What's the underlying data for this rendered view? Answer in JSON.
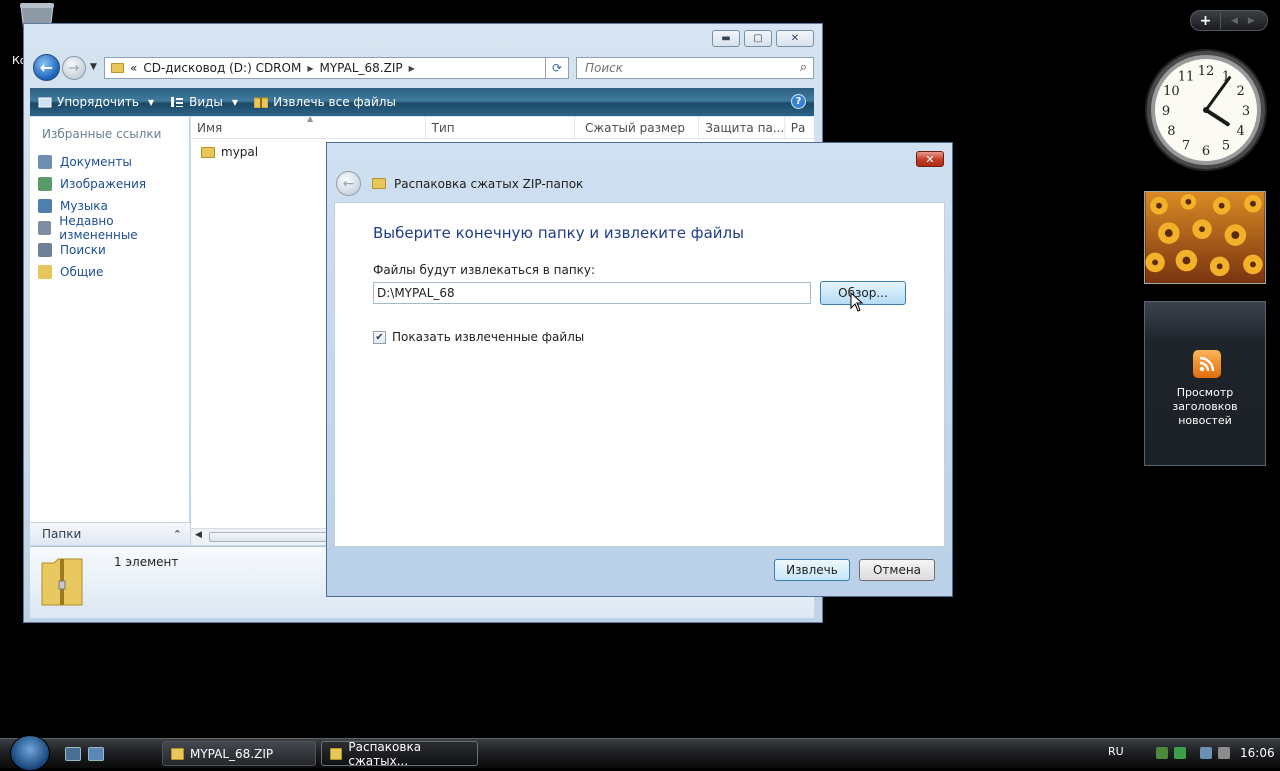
{
  "desktop": {
    "fragment_text": "Ко"
  },
  "explorer": {
    "address": {
      "prefix": "«",
      "part1": "CD-дисковод (D:) CDROM",
      "part2": "MYPAL_68.ZIP"
    },
    "search_placeholder": "Поиск",
    "toolbar": {
      "organize": "Упорядочить",
      "views": "Виды",
      "extract_all": "Извлечь все файлы",
      "help": "?"
    },
    "favorites": {
      "title": "Избранные ссылки",
      "items": [
        {
          "label": "Документы"
        },
        {
          "label": "Изображения"
        },
        {
          "label": "Музыка"
        },
        {
          "label": "Недавно измененные"
        },
        {
          "label": "Поиски"
        },
        {
          "label": "Общие"
        }
      ]
    },
    "folders_label": "Папки",
    "columns": [
      "Имя",
      "Тип",
      "Сжатый размер",
      "Защита па...",
      "Ра"
    ],
    "files": [
      {
        "name": "mypal"
      }
    ],
    "status": {
      "count": "1 элемент"
    }
  },
  "dialog": {
    "title": "Распаковка сжатых ZIP-папок",
    "heading": "Выберите конечную папку и извлеките файлы",
    "path_label": "Файлы будут извлекаться в папку:",
    "path_value": "D:\\MYPAL_68",
    "browse": "Обзор...",
    "show_files_label": "Показать извлеченные файлы",
    "show_files_checked": true,
    "extract": "Извлечь",
    "cancel": "Отмена"
  },
  "sidebar": {
    "clock": {
      "numerals": [
        "12",
        "1",
        "2",
        "3",
        "4",
        "5",
        "6",
        "7",
        "8",
        "9",
        "10",
        "11"
      ],
      "hour": 4,
      "minute": 6
    },
    "feeds_label_line1": "Просмотр заголовков",
    "feeds_label_line2": "новостей"
  },
  "taskbar": {
    "tasks": [
      {
        "label": "MYPAL_68.ZIP"
      },
      {
        "label": "Распаковка сжатых..."
      }
    ],
    "language": "RU",
    "time": "16:06"
  }
}
